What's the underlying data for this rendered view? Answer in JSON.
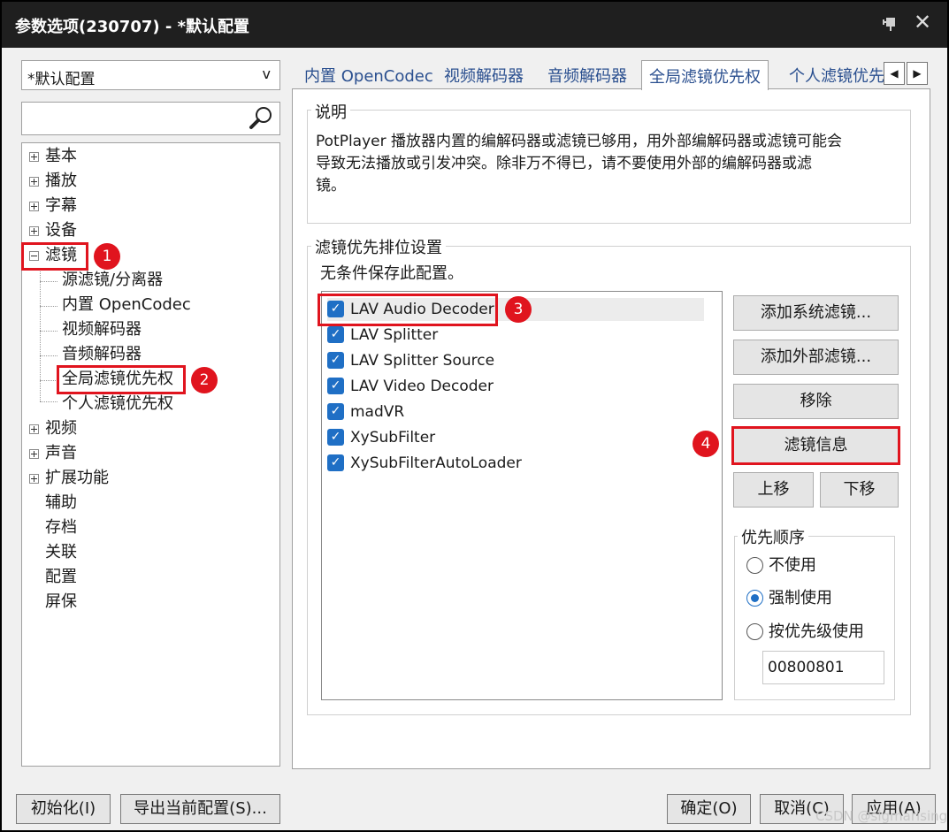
{
  "window": {
    "title": "参数选项(230707) - *默认配置",
    "pin_icon": "pin-icon",
    "close_icon": "close-icon"
  },
  "left": {
    "profile_select": {
      "value": "*默认配置",
      "arrow": "v"
    },
    "search": {
      "value": "",
      "icon": "magnifier-icon"
    },
    "tree": [
      {
        "label": "基本",
        "expander": "plus"
      },
      {
        "label": "播放",
        "expander": "plus"
      },
      {
        "label": "字幕",
        "expander": "plus"
      },
      {
        "label": "设备",
        "expander": "plus"
      },
      {
        "label": "滤镜",
        "expander": "minus"
      },
      {
        "label": "源滤镜/分离器"
      },
      {
        "label": "内置 OpenCodec"
      },
      {
        "label": "视频解码器"
      },
      {
        "label": "音频解码器"
      },
      {
        "label": "全局滤镜优先权"
      },
      {
        "label": "个人滤镜优先权"
      },
      {
        "label": "视频",
        "expander": "plus"
      },
      {
        "label": "声音",
        "expander": "plus"
      },
      {
        "label": "扩展功能",
        "expander": "plus"
      },
      {
        "label": "辅助"
      },
      {
        "label": "存档"
      },
      {
        "label": "关联"
      },
      {
        "label": "配置"
      },
      {
        "label": "屏保"
      }
    ]
  },
  "tabs": [
    {
      "label": "内置 OpenCodec"
    },
    {
      "label": "视频解码器"
    },
    {
      "label": "音频解码器"
    },
    {
      "label": "全局滤镜优先权",
      "active": true
    },
    {
      "label": "个人滤镜优先"
    }
  ],
  "tab_scroll": {
    "left": "◀",
    "right": "▶"
  },
  "description": {
    "title": "说明",
    "text_line1": "PotPlayer 播放器内置的编解码器或滤镜已够用，用外部编解码器或滤镜可能会",
    "text_line2": "导致无法播放或引发冲突。除非万不得已，请不要使用外部的编解码器或滤",
    "text_line3": "镜。"
  },
  "priority": {
    "title": "滤镜优先排位设置",
    "note": "无条件保存此配置。",
    "filters": [
      {
        "name": "LAV Audio Decoder",
        "checked": true,
        "selected": true
      },
      {
        "name": "LAV Splitter",
        "checked": true
      },
      {
        "name": "LAV Splitter Source",
        "checked": true
      },
      {
        "name": "LAV Video Decoder",
        "checked": true
      },
      {
        "name": "madVR",
        "checked": true
      },
      {
        "name": "XySubFilter",
        "checked": true
      },
      {
        "name": "XySubFilterAutoLoader",
        "checked": true
      }
    ],
    "buttons": {
      "add_system": "添加系统滤镜...",
      "add_external": "添加外部滤镜...",
      "remove": "移除",
      "info": "滤镜信息",
      "up": "上移",
      "down": "下移"
    },
    "order": {
      "title": "优先顺序",
      "options": [
        "不使用",
        "强制使用",
        "按优先级使用"
      ],
      "selected": "强制使用",
      "merit_value": "00800801"
    }
  },
  "annotations": [
    "1",
    "2",
    "3",
    "4"
  ],
  "annotation_color": "#e0141e",
  "bottom": {
    "init": "初始化(I)",
    "export": "导出当前配置(S)...",
    "ok": "确定(O)",
    "cancel": "取消(C)",
    "apply": "应用(A)"
  },
  "watermark": "CSDN @sigmarising"
}
